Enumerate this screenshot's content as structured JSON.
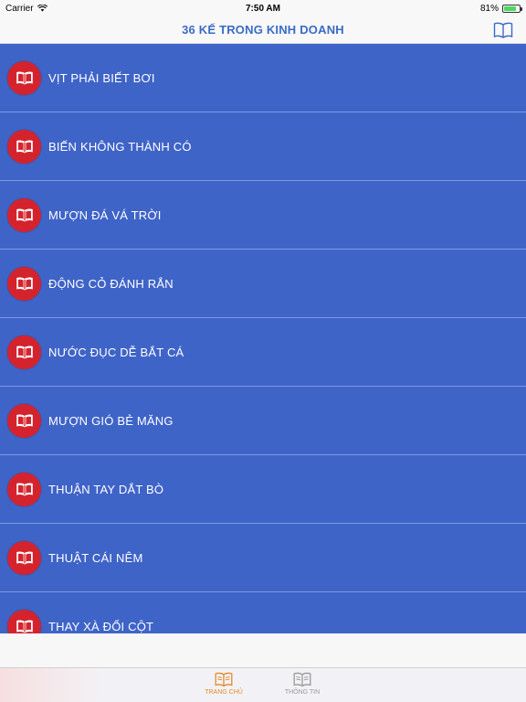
{
  "status_bar": {
    "carrier": "Carrier",
    "time": "7:50 AM",
    "battery_percent": "81%",
    "battery_level": 0.81
  },
  "nav": {
    "title": "36 KẾ TRONG KINH DOANH"
  },
  "list": {
    "items": [
      {
        "label": "VỊT PHẢI BIẾT BƠI"
      },
      {
        "label": "BIẾN KHÔNG THÀNH CÓ"
      },
      {
        "label": "MƯỢN ĐÁ VÁ TRỜI"
      },
      {
        "label": "ĐỘNG CỎ ĐÁNH RẮN"
      },
      {
        "label": "NƯỚC ĐỤC DỄ BẮT CÁ"
      },
      {
        "label": "MƯỢN GIÓ BẺ MĂNG"
      },
      {
        "label": "THUẬN TAY DẮT BÒ"
      },
      {
        "label": "THUẬT CÁI NÊM"
      },
      {
        "label": "THAY XÀ ĐỔI CỘT"
      }
    ]
  },
  "tabs": [
    {
      "label": "TRANG CHỦ",
      "active": true
    },
    {
      "label": "THÔNG TIN",
      "active": false
    }
  ],
  "colors": {
    "accent": "#3a6bc7",
    "list_bg": "#3f64c8",
    "icon_bg": "#d5232d",
    "tab_active": "#e48a2a",
    "tab_inactive": "#9a9a9a"
  }
}
